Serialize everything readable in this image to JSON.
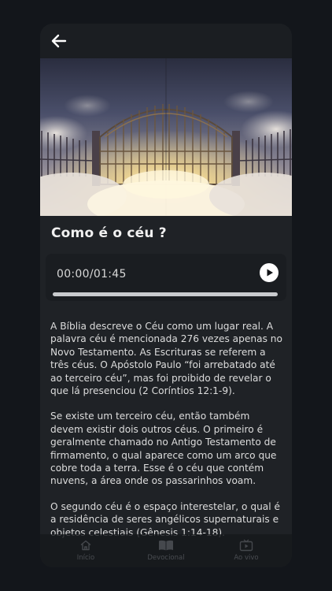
{
  "header": {
    "back_icon": "arrow-left-icon"
  },
  "hero": {
    "image": "heaven-gates-image"
  },
  "devotional": {
    "title": "Como é o céu ?"
  },
  "player": {
    "time_label": "00:00/01:45",
    "progress": 0,
    "play_icon": "play-icon"
  },
  "content": {
    "paragraphs": [
      "A Bíblia descreve o Céu como um lugar real. A palavra céu é mencionada 276 vezes apenas no Novo Testamento. As Escrituras se referem a três céus. O Apóstolo Paulo “foi arrebatado até ao terceiro céu”, mas foi proibido de revelar o que lá presenciou (2 Coríntios 12:1-9).",
      "Se existe um terceiro céu, então também devem existir dois outros céus. O primeiro é geralmente chamado no Antigo Testamento de firmamento, o qual aparece como um arco que cobre toda a terra. Esse é o céu que contém nuvens, a área onde os passarinhos voam.",
      "O segundo céu é o espaço interestelar, o qual é a residência de seres angélicos supernaturais e objetos celestiais (Gênesis 1:14-18)."
    ]
  },
  "tabbar": {
    "items": [
      {
        "label": "Início",
        "icon": "home-icon"
      },
      {
        "label": "Devocional",
        "icon": "book-icon"
      },
      {
        "label": "Ao vivo",
        "icon": "tv-icon"
      }
    ]
  }
}
